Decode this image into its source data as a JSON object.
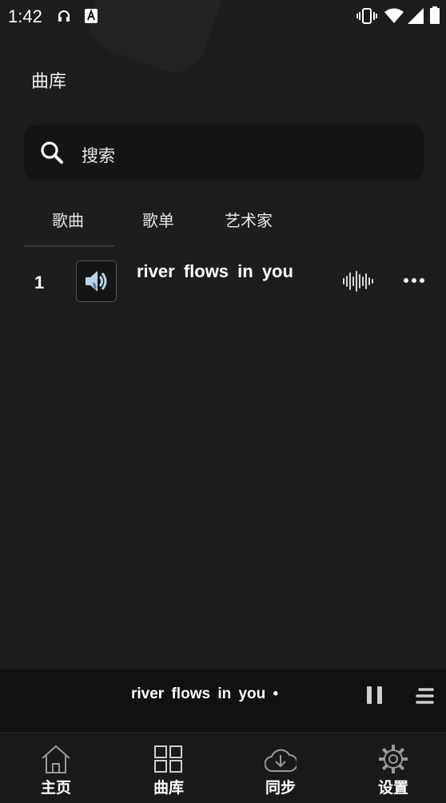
{
  "status_bar": {
    "time": "1:42"
  },
  "header": {
    "title": "曲库"
  },
  "search": {
    "placeholder": "搜索"
  },
  "tabs": [
    {
      "label": "歌曲"
    },
    {
      "label": "歌单"
    },
    {
      "label": "艺术家"
    }
  ],
  "songs": [
    {
      "index": "1",
      "title": "river flows in you"
    }
  ],
  "mini_player": {
    "title": "river flows in you •"
  },
  "bottom_nav": [
    {
      "label": "主页",
      "icon": "home-icon"
    },
    {
      "label": "曲库",
      "icon": "library-grid-icon"
    },
    {
      "label": "同步",
      "icon": "cloud-download-icon"
    },
    {
      "label": "设置",
      "icon": "gear-icon"
    }
  ]
}
